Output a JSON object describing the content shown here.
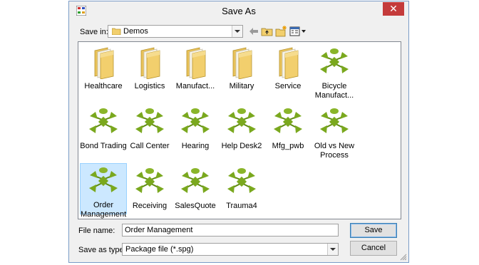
{
  "window": {
    "title": "Save As",
    "close_glyph": "✕"
  },
  "toolbar": {
    "look_in_label": "Save in:",
    "look_in_value": "Demos",
    "back_icon": "back-arrow-icon",
    "up_icon": "up-folder-icon",
    "new_folder_icon": "new-folder-icon",
    "view_menu_icon": "view-menu-icon"
  },
  "items": [
    {
      "label": "Healthcare",
      "icon": "folder-icon",
      "selected": false
    },
    {
      "label": "Logistics",
      "icon": "folder-icon",
      "selected": false
    },
    {
      "label": "Manufact...",
      "icon": "folder-icon",
      "selected": false
    },
    {
      "label": "Military",
      "icon": "folder-icon",
      "selected": false
    },
    {
      "label": "Service",
      "icon": "folder-icon",
      "selected": false
    },
    {
      "label": "Bicycle Manufact...",
      "icon": "package-icon",
      "selected": false
    },
    {
      "label": "Bond Trading",
      "icon": "package-icon",
      "selected": false
    },
    {
      "label": "Call Center",
      "icon": "package-icon",
      "selected": false
    },
    {
      "label": "Hearing",
      "icon": "package-icon",
      "selected": false
    },
    {
      "label": "Help Desk2",
      "icon": "package-icon",
      "selected": false
    },
    {
      "label": "Mfg_pwb",
      "icon": "package-icon",
      "selected": false
    },
    {
      "label": "Old vs New Process",
      "icon": "package-icon",
      "selected": false
    },
    {
      "label": "Order Management",
      "icon": "package-icon",
      "selected": true
    },
    {
      "label": "Receiving",
      "icon": "package-icon",
      "selected": false
    },
    {
      "label": "SalesQuote",
      "icon": "package-icon",
      "selected": false
    },
    {
      "label": "Trauma4",
      "icon": "package-icon",
      "selected": false
    }
  ],
  "form": {
    "file_name_label": "File name:",
    "file_name_value": "Order Management",
    "save_type_label": "Save as type:",
    "save_type_value": "Package file (*.spg)"
  },
  "buttons": {
    "save": "Save",
    "cancel": "Cancel"
  },
  "colors": {
    "folder": "#f2cf6d",
    "package_green": "#7aa81e",
    "selection": "#cce8ff",
    "close_red": "#c43b3b"
  }
}
